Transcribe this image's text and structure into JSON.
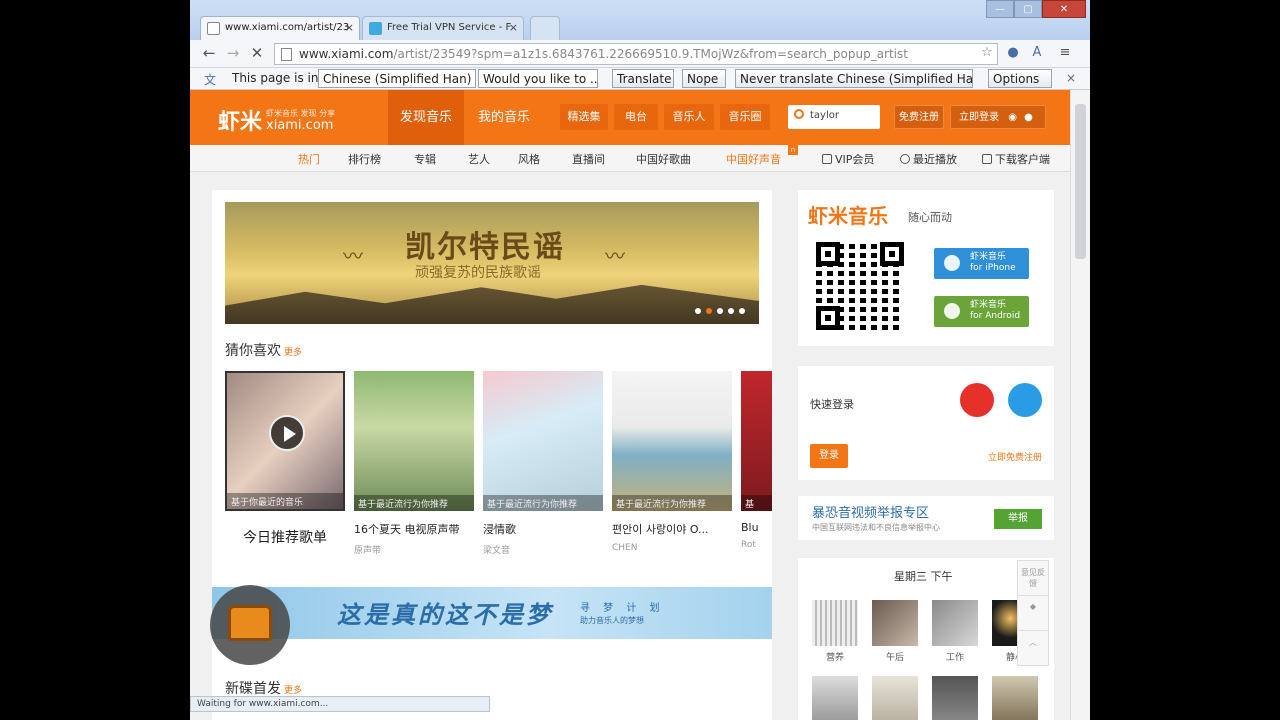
{
  "browser": {
    "tabs": [
      {
        "label": "www.xiami.com/artist/23",
        "close": "×"
      },
      {
        "label": "Free Trial VPN Service - F",
        "close": "×"
      }
    ],
    "window_buttons": {
      "minimize": "—",
      "maximize": "▢",
      "close": "✕"
    },
    "url": {
      "host": "www.xiami.com",
      "path": "/artist/23549?spm=a1z1s.6843761.226669510.9.TMojWz&from=search_popup_artist"
    },
    "nav": {
      "back": "←",
      "forward": "→",
      "stop": "✕"
    },
    "toolbar_icons": {
      "star": "☆",
      "menu": "≡"
    }
  },
  "translate_bar": {
    "prefix": "This page is in",
    "language": "Chinese (Simplified Han)",
    "question": "Would you like to ...",
    "translate": "Translate",
    "nope": "Nope",
    "never": "Never translate Chinese (Simplified Han)",
    "options": "Options",
    "close": "×"
  },
  "header": {
    "logo_cn": "虾米",
    "logo_small": "虾米音乐 发现 分享",
    "logo_en": "xiami.com",
    "main_nav": [
      "发现音乐",
      "我的音乐"
    ],
    "sub_nav": [
      "精选集",
      "电台",
      "音乐人",
      "音乐圈"
    ],
    "search_value": "taylor",
    "register": "免费注册",
    "login": "立即登录"
  },
  "categories": [
    "热门",
    "排行榜",
    "专辑",
    "艺人",
    "风格",
    "直播间",
    "中国好歌曲",
    "中国好声音"
  ],
  "right_links": [
    "VIP会员",
    "最近播放",
    "下载客户端"
  ],
  "banner": {
    "title": "凯尔特民谣",
    "subtitle": "顽强复苏的民族歌谣"
  },
  "recommend": {
    "title": "猜你喜欢",
    "more": "更多",
    "cards": [
      {
        "caption": "基于你最近的音乐",
        "name": "今日推荐歌单",
        "artist": ""
      },
      {
        "caption": "基于最近流行为你推荐",
        "name": "16个夏天 电视原声带",
        "artist": "原声带"
      },
      {
        "caption": "基于最近流行为你推荐",
        "name": "浸情歌",
        "artist": "梁文音"
      },
      {
        "caption": "基于最近流行为你推荐",
        "name": "편안이 사랑이야 O...",
        "artist": "CHEN"
      },
      {
        "caption": "基",
        "name": "Blu",
        "artist": "Rot"
      }
    ]
  },
  "promo": {
    "text": "这是真的这不是梦",
    "sub": "寻 梦 计 划",
    "sub2": "助力音乐人的梦想"
  },
  "new_release": {
    "title": "新碟首发",
    "more": "更多"
  },
  "status": "Waiting for www.xiami.com...",
  "sidebar": {
    "brand": "虾米音乐",
    "slogan": "随心而动",
    "iphone": [
      "虾米音乐",
      "for iPhone"
    ],
    "android": [
      "虾米音乐",
      "for Android"
    ],
    "quick_login": "快速登录",
    "login": "登录",
    "register": "立即免费注册",
    "report_title": "暴恐音视频举报专区",
    "report_sub": "中国互联网违法和不良信息举报中心",
    "report_btn": "举报",
    "time_title": "星期三 下午",
    "moods": [
      "营养",
      "午后",
      "工作",
      "静心"
    ]
  },
  "float_tools": [
    "意见反馈",
    "",
    ""
  ]
}
